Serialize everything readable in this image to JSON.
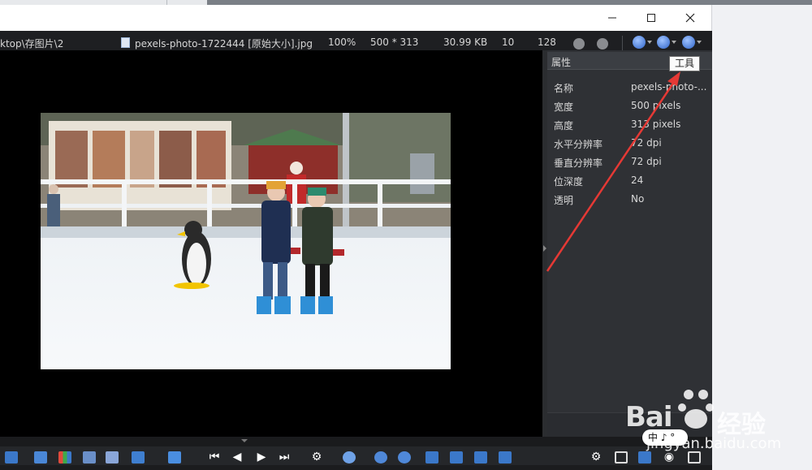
{
  "window": {
    "minimize_glyph": "—",
    "maximize_glyph": "☐",
    "close_glyph": "✕"
  },
  "infobar": {
    "path": "ktop\\存图片\\2",
    "file_name": "pexels-photo-1722444 [原始大小].jpg",
    "zoom": "100%",
    "dimensions": "500 * 313",
    "file_size": "30.99 KB",
    "value_a": "10",
    "value_b": "128"
  },
  "panel": {
    "title": "属性",
    "properties": [
      {
        "key": "名称",
        "value": "pexels-photo-..."
      },
      {
        "key": "宽度",
        "value": "500 pixels"
      },
      {
        "key": "高度",
        "value": "313 pixels"
      },
      {
        "key": "水平分辨率",
        "value": "72 dpi"
      },
      {
        "key": "垂直分辨率",
        "value": "72 dpi"
      },
      {
        "key": "位深度",
        "value": "24"
      },
      {
        "key": "透明",
        "value": "No"
      }
    ]
  },
  "tooltip": {
    "text": "工具"
  },
  "toolbar": {
    "icons": [
      "crop-icon",
      "chart-icon",
      "screen-icon",
      "edit-icon",
      "pen-icon",
      "export-icon",
      "first-icon",
      "prev-icon",
      "next-icon",
      "last-icon",
      "settings-icon",
      "zoom-icon",
      "zoom-out-icon",
      "zoom-in-icon",
      "fit-width-icon",
      "fit-icon",
      "stretch-h-icon",
      "stretch-v-icon"
    ]
  },
  "watermark": {
    "brand": "Bai",
    "brand_cn": "经验",
    "url": "jingyan.baidu.com",
    "ime": "中 ♪ °"
  },
  "colors": {
    "panel_bg": "#2f3135",
    "viewer_bg": "#000000",
    "annotation": "#e53935",
    "accent_blue": "#2f64c9"
  }
}
